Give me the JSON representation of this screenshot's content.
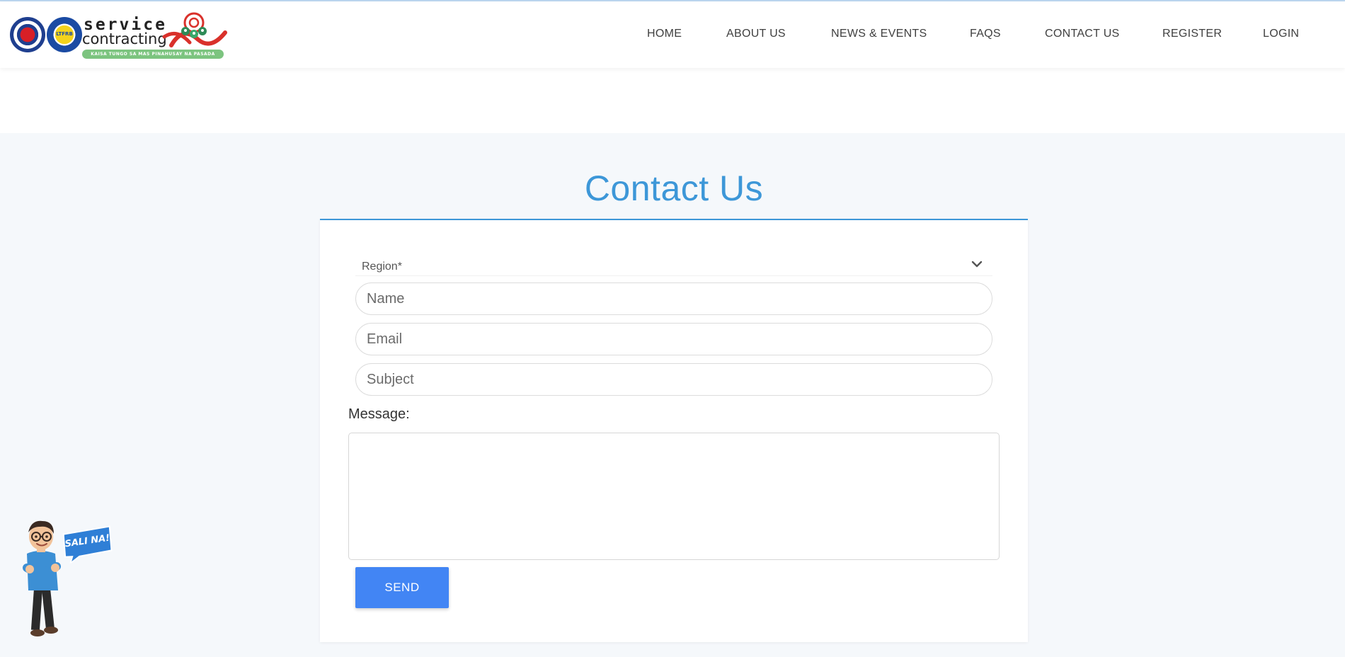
{
  "brand": {
    "line1": "service",
    "line2": "contracting",
    "tagline": "KAISA TUNGO SA MAS PINAHUSAY NA PASADA",
    "ltfrb_seal_text": "LTFRB"
  },
  "nav": {
    "items": [
      {
        "label": "HOME"
      },
      {
        "label": "ABOUT US"
      },
      {
        "label": "NEWS & EVENTS"
      },
      {
        "label": "FAQS"
      },
      {
        "label": "CONTACT US"
      },
      {
        "label": "REGISTER"
      },
      {
        "label": "LOGIN"
      }
    ]
  },
  "page": {
    "title": "Contact Us"
  },
  "form": {
    "region_label": "Region*",
    "name_placeholder": "Name",
    "email_placeholder": "Email",
    "subject_placeholder": "Subject",
    "message_label": "Message:",
    "message_value": "",
    "send_label": "SEND"
  },
  "mascot": {
    "bubble_text": "SALI NA!"
  },
  "colors": {
    "accent": "#3d97d8",
    "button": "#4285f4",
    "background": "#f5f8fb"
  },
  "icons": {
    "region_dropdown": "chevron-down-icon"
  }
}
